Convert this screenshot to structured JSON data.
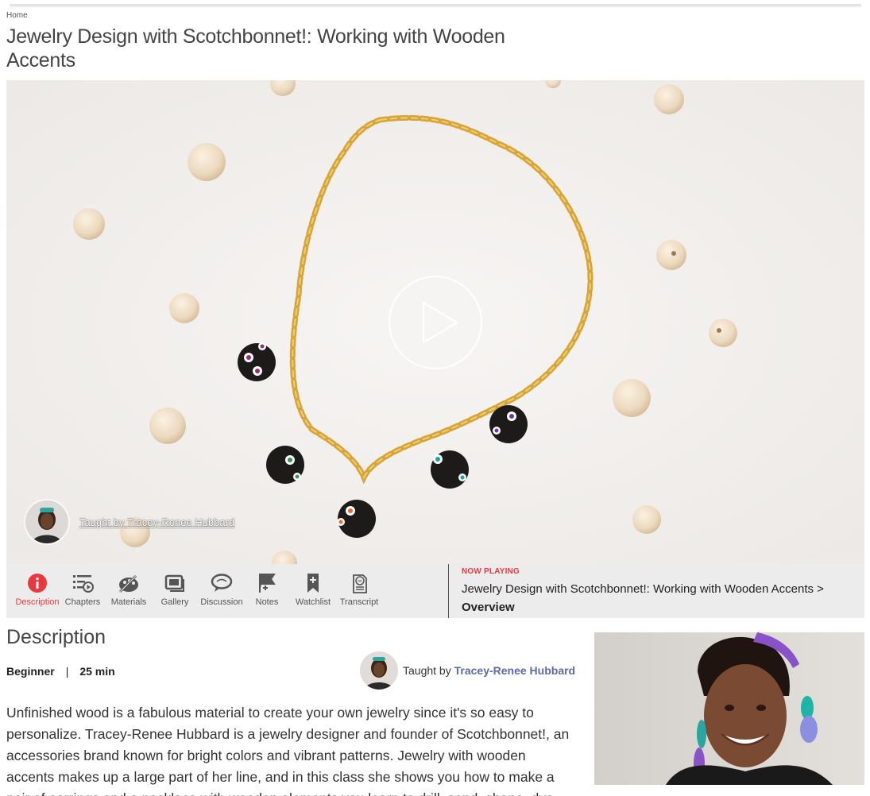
{
  "breadcrumb": {
    "home": "Home"
  },
  "page": {
    "title": "Jewelry Design with Scotchbonnet!: Working with Wooden Accents"
  },
  "video": {
    "taught_by_prefix": "Taught by ",
    "instructor": "Tracey-Renee Hubbard",
    "play_icon": "play-icon"
  },
  "toolbar": {
    "items": [
      {
        "label": "Description",
        "icon": "info-icon",
        "active": true
      },
      {
        "label": "Chapters",
        "icon": "chapters-icon"
      },
      {
        "label": "Materials",
        "icon": "materials-icon"
      },
      {
        "label": "Gallery",
        "icon": "gallery-icon"
      },
      {
        "label": "Discussion",
        "icon": "discussion-icon"
      },
      {
        "label": "Notes",
        "icon": "notes-icon"
      },
      {
        "label": "Watchlist",
        "icon": "bookmark-icon"
      },
      {
        "label": "Transcript",
        "icon": "transcript-icon"
      }
    ],
    "now_playing_label": "NOW PLAYING",
    "now_playing_title": "Jewelry Design with Scotchbonnet!: Working with Wooden Accents >",
    "now_playing_sub": "Overview"
  },
  "description": {
    "heading": "Description",
    "level": "Beginner",
    "separator": "|",
    "duration": "25 min",
    "taught_by": "Taught by",
    "instructor": "Tracey-Renee Hubbard",
    "body": "Unfinished wood is a fabulous material to create your own jewelry since it's so easy to personalize. Tracey-Renee Hubbard is a jewelry designer and founder of Scotchbonnet!, an accessories brand known for bright colors and vibrant patterns. Jewelry with wooden accents makes up a large part of her line, and in this class she shows you how to make a pair of earrings and a necklace with wooden elements you learn to drill, sand, shape, dye and paint it to"
  },
  "colors": {
    "accent": "#e8383d",
    "link": "#5a6aa8",
    "toolbar_bg": "#ececec"
  }
}
